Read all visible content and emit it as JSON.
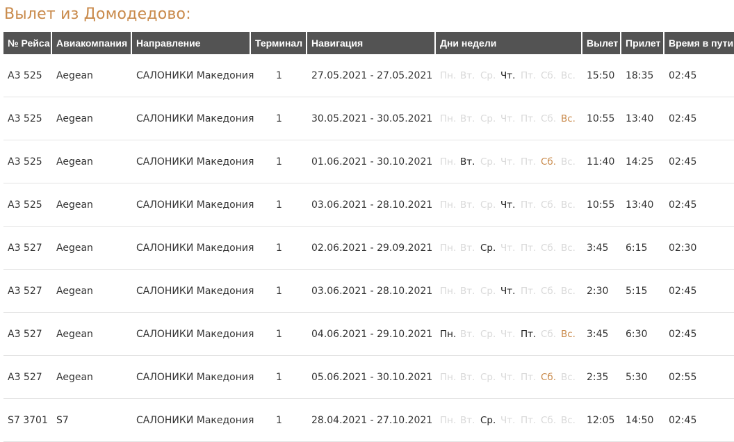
{
  "title": "Вылет из Домодедово:",
  "headers": [
    "№ Рейса",
    "Авиакомпания",
    "Направление",
    "Терминал",
    "Навигация",
    "Дни недели",
    "Вылет",
    "Прилет",
    "Время в пути"
  ],
  "day_names": [
    "Пн.",
    "Вт.",
    "Ср.",
    "Чт.",
    "Пт.",
    "Сб.",
    "Вс."
  ],
  "colors": {
    "header_bg": "#535353",
    "accent": "#c98a4b",
    "inactive_day": "#d9d9d9"
  },
  "rows": [
    {
      "flight": "A3 525",
      "airline": "Aegean",
      "direction": "САЛОНИКИ Македония",
      "terminal": "1",
      "period": "27.05.2021 - 27.05.2021",
      "days": [
        0,
        0,
        0,
        1,
        0,
        0,
        0
      ],
      "dep": "15:50",
      "arr": "18:35",
      "duration": "02:45"
    },
    {
      "flight": "A3 525",
      "airline": "Aegean",
      "direction": "САЛОНИКИ Македония",
      "terminal": "1",
      "period": "30.05.2021 - 30.05.2021",
      "days": [
        0,
        0,
        0,
        0,
        0,
        0,
        1
      ],
      "dep": "10:55",
      "arr": "13:40",
      "duration": "02:45"
    },
    {
      "flight": "A3 525",
      "airline": "Aegean",
      "direction": "САЛОНИКИ Македония",
      "terminal": "1",
      "period": "01.06.2021 - 30.10.2021",
      "days": [
        0,
        1,
        0,
        0,
        0,
        1,
        0
      ],
      "dep": "11:40",
      "arr": "14:25",
      "duration": "02:45"
    },
    {
      "flight": "A3 525",
      "airline": "Aegean",
      "direction": "САЛОНИКИ Македония",
      "terminal": "1",
      "period": "03.06.2021 - 28.10.2021",
      "days": [
        0,
        0,
        0,
        1,
        0,
        0,
        0
      ],
      "dep": "10:55",
      "arr": "13:40",
      "duration": "02:45"
    },
    {
      "flight": "A3 527",
      "airline": "Aegean",
      "direction": "САЛОНИКИ Македония",
      "terminal": "1",
      "period": "02.06.2021 - 29.09.2021",
      "days": [
        0,
        0,
        1,
        0,
        0,
        0,
        0
      ],
      "dep": "3:45",
      "arr": "6:15",
      "duration": "02:30"
    },
    {
      "flight": "A3 527",
      "airline": "Aegean",
      "direction": "САЛОНИКИ Македония",
      "terminal": "1",
      "period": "03.06.2021 - 28.10.2021",
      "days": [
        0,
        0,
        0,
        1,
        0,
        0,
        0
      ],
      "dep": "2:30",
      "arr": "5:15",
      "duration": "02:45"
    },
    {
      "flight": "A3 527",
      "airline": "Aegean",
      "direction": "САЛОНИКИ Македония",
      "terminal": "1",
      "period": "04.06.2021 - 29.10.2021",
      "days": [
        1,
        0,
        0,
        0,
        1,
        0,
        1
      ],
      "dep": "3:45",
      "arr": "6:30",
      "duration": "02:45"
    },
    {
      "flight": "A3 527",
      "airline": "Aegean",
      "direction": "САЛОНИКИ Македония",
      "terminal": "1",
      "period": "05.06.2021 - 30.10.2021",
      "days": [
        0,
        0,
        0,
        0,
        0,
        1,
        0
      ],
      "dep": "2:35",
      "arr": "5:30",
      "duration": "02:55"
    },
    {
      "flight": "S7 3701",
      "airline": "S7",
      "direction": "САЛОНИКИ Македония",
      "terminal": "1",
      "period": "28.04.2021 - 27.10.2021",
      "days": [
        0,
        0,
        1,
        0,
        0,
        0,
        0
      ],
      "dep": "12:05",
      "arr": "14:50",
      "duration": "02:45"
    }
  ]
}
